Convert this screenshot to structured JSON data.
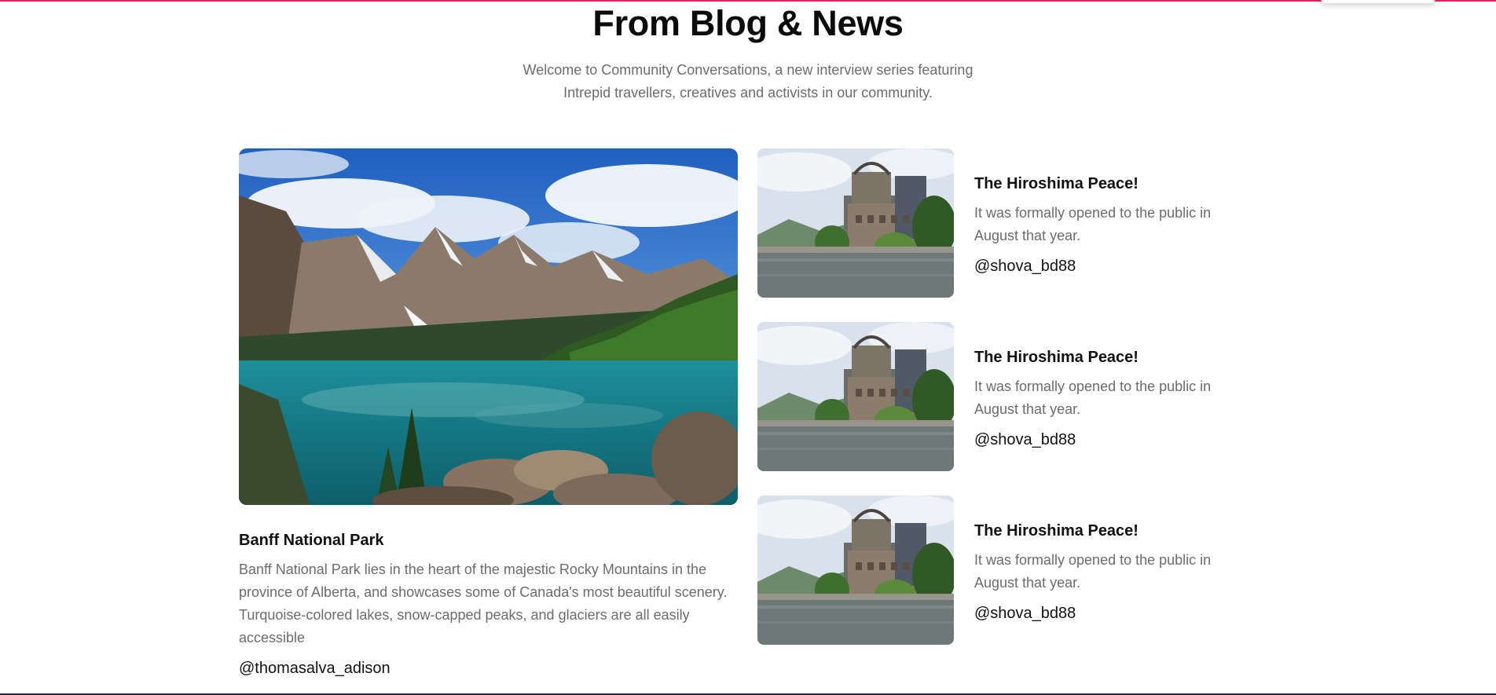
{
  "section": {
    "title": "From Blog & News",
    "subtitle": "Welcome to Community Conversations, a new interview series featuring Intrepid travellers, creatives and activists in our community."
  },
  "featured": {
    "title": "Banff National Park",
    "description": "Banff National Park lies in the heart of the majestic Rocky Mountains in the province of Alberta, and showcases some of Canada's most beautiful scenery. Turquoise-colored lakes, snow-capped peaks, and glaciers are all easily accessible",
    "author": "@thomasalva_adison",
    "image": "mountain-lake-photo"
  },
  "posts": [
    {
      "title": "The Hiroshima Peace!",
      "description": "It was formally opened to the public in August that year.",
      "author": "@shova_bd88",
      "image": "dome-riverside-photo"
    },
    {
      "title": "The Hiroshima Peace!",
      "description": "It was formally opened to the public in August that year.",
      "author": "@shova_bd88",
      "image": "dome-riverside-photo"
    },
    {
      "title": "The Hiroshima Peace!",
      "description": "It was formally opened to the public in August that year.",
      "author": "@shova_bd88",
      "image": "dome-riverside-photo"
    }
  ],
  "colors": {
    "accent": "#e0245e",
    "muted_text": "#6c6c6c",
    "heading": "#111111"
  }
}
